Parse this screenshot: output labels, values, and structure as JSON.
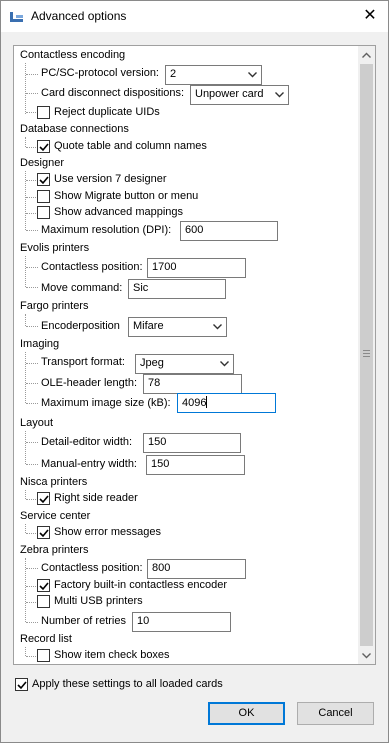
{
  "window": {
    "title": "Advanced options",
    "close_glyph": "✕",
    "icon": "app-tool-icon"
  },
  "groups": {
    "contactless": {
      "title": "Contactless encoding",
      "pcsc_label": "PC/SC-protocol version:",
      "pcsc_value": "2",
      "disconnect_label": "Card disconnect dispositions:",
      "disconnect_value": "Unpower card",
      "reject_label": "Reject duplicate UIDs",
      "reject_checked": false
    },
    "database": {
      "title": "Database connections",
      "quote_label": "Quote table and column names",
      "quote_checked": true
    },
    "designer": {
      "title": "Designer",
      "v7_label": "Use version 7 designer",
      "v7_checked": true,
      "migrate_label": "Show Migrate button or menu",
      "migrate_checked": false,
      "mappings_label": "Show advanced mappings",
      "mappings_checked": false,
      "dpi_label": "Maximum resolution (DPI):",
      "dpi_value": "600"
    },
    "evolis": {
      "title": "Evolis printers",
      "position_label": "Contactless position:",
      "position_value": "1700",
      "move_label": "Move command:",
      "move_value": "Sic"
    },
    "fargo": {
      "title": "Fargo printers",
      "encoder_label": "Encoderposition",
      "encoder_value": "Mifare"
    },
    "imaging": {
      "title": "Imaging",
      "transport_label": "Transport format:",
      "transport_value": "Jpeg",
      "ole_label": "OLE-header length:",
      "ole_value": "78",
      "maxsize_label": "Maximum image size (kB):",
      "maxsize_value": "4096"
    },
    "layout": {
      "title": "Layout",
      "detail_label": "Detail-editor width:",
      "detail_value": "150",
      "manual_label": "Manual-entry width:",
      "manual_value": "150"
    },
    "nisca": {
      "title": "Nisca printers",
      "right_label": "Right side reader",
      "right_checked": true
    },
    "service": {
      "title": "Service center",
      "errors_label": "Show error messages",
      "errors_checked": true
    },
    "zebra": {
      "title": "Zebra printers",
      "position_label": "Contactless position:",
      "position_value": "800",
      "factory_label": "Factory built-in contactless encoder",
      "factory_checked": true,
      "multiusb_label": "Multi USB printers",
      "multiusb_checked": false,
      "retries_label": "Number of retries",
      "retries_value": "10"
    },
    "record": {
      "title": "Record list",
      "checkboxes_label": "Show item check boxes",
      "checkboxes_checked": false
    }
  },
  "footer": {
    "apply_label": "Apply these settings to all loaded cards",
    "apply_checked": true,
    "ok_label": "OK",
    "cancel_label": "Cancel"
  },
  "colors": {
    "focus_border": "#0078d7",
    "check_mark": "#000000",
    "scroll_thumb": "#cdcdcd"
  }
}
